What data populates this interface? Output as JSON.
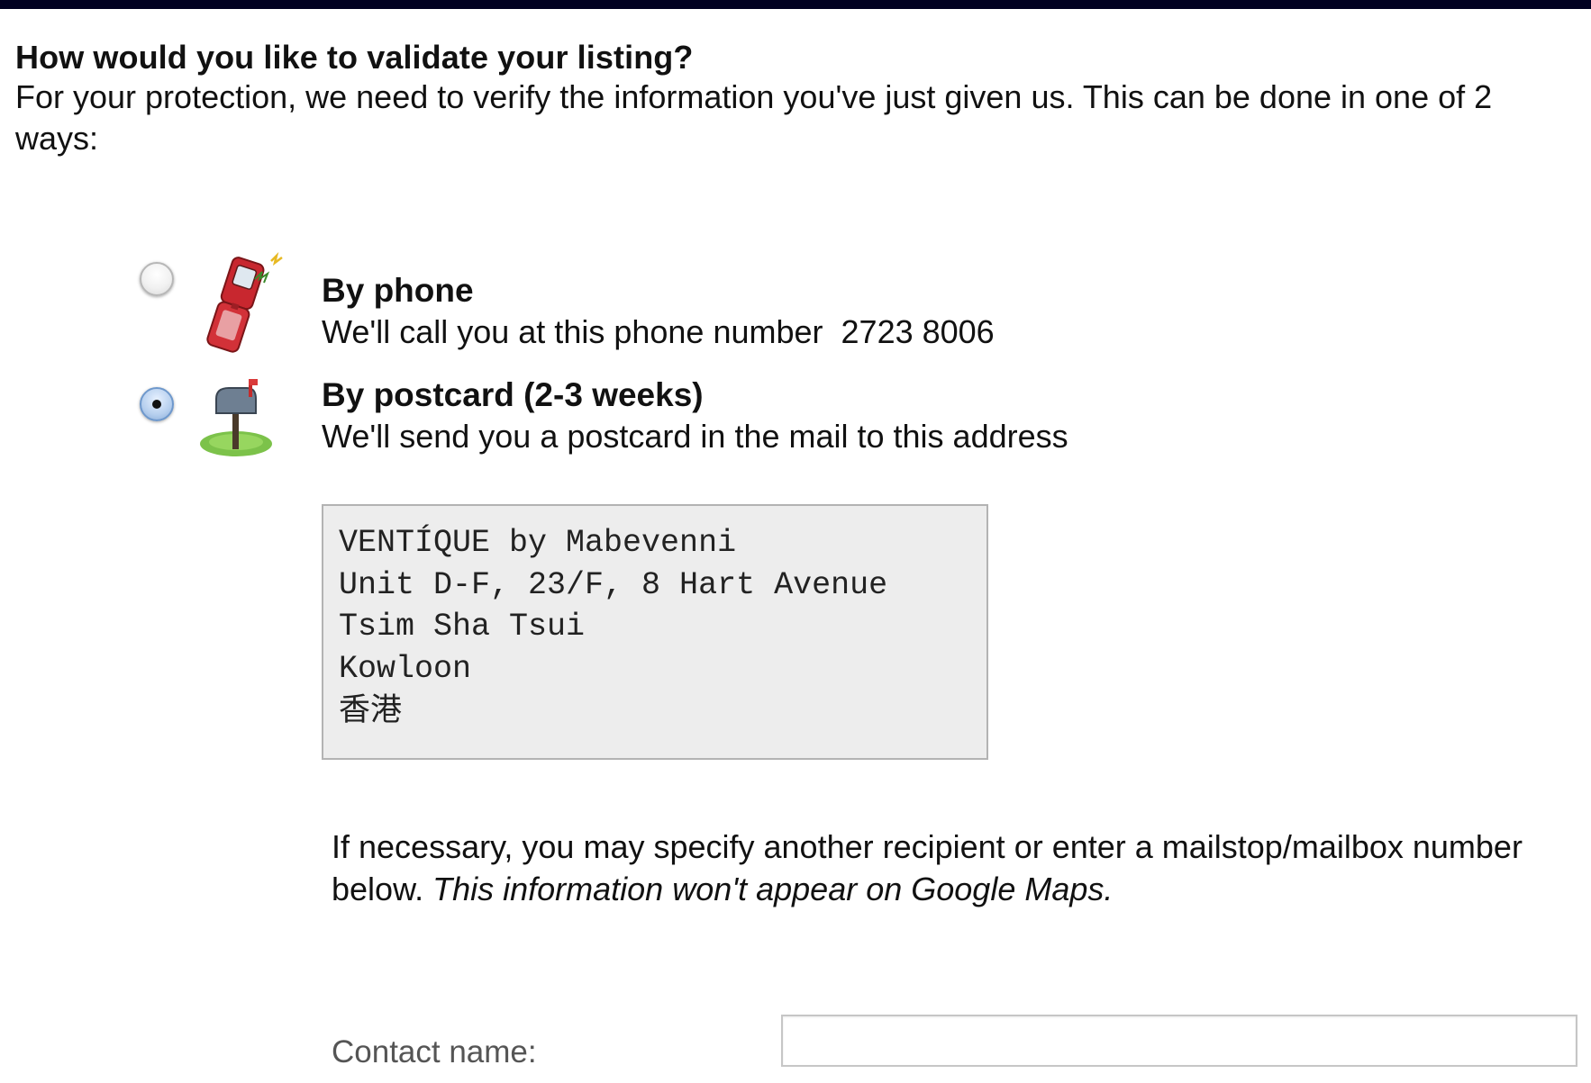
{
  "header": {
    "title": "How would you like to validate your listing?",
    "intro": "For your protection, we need to verify the information you've just given us. This can be done in one of 2 ways:"
  },
  "options": {
    "phone": {
      "selected": false,
      "icon": "flip-phone-icon",
      "title": "By phone",
      "description": "We'll call you at this phone number",
      "phone_number": "2723 8006"
    },
    "postcard": {
      "selected": true,
      "icon": "mailbox-icon",
      "title": "By postcard (2-3 weeks)",
      "description": "We'll send you a postcard in the mail to this address"
    }
  },
  "address": {
    "lines": [
      "VENTÍQUE by Mabevenni",
      "Unit D-F, 23/F, 8 Hart Avenue",
      "Tsim Sha Tsui",
      "Kowloon",
      "香港"
    ]
  },
  "note": {
    "text": "If necessary, you may specify another recipient or enter a mailstop/mailbox number below.",
    "italic": "This information won't appear on Google Maps."
  },
  "contact": {
    "label": "Contact name:",
    "value": "",
    "placeholder": ""
  },
  "colors": {
    "frame": "#000021",
    "address_bg": "#ededed",
    "radio_selected": "#88abd8"
  }
}
